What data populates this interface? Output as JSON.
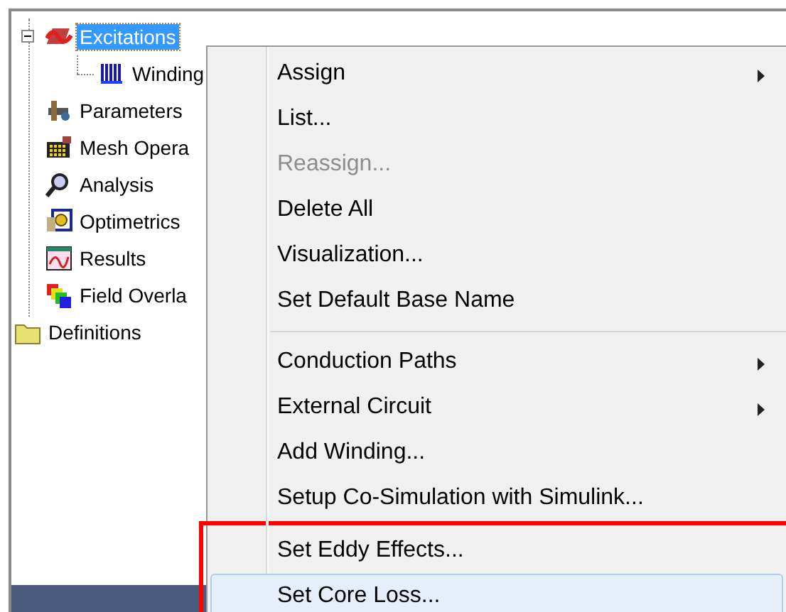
{
  "tree": {
    "items": [
      {
        "label": "Excitations",
        "kind": "excitations",
        "selected": true,
        "expanded": true,
        "children": [
          {
            "label": "Winding",
            "kind": "winding",
            "selected": false
          }
        ]
      },
      {
        "label": "Parameters",
        "kind": "parameters",
        "selected": false
      },
      {
        "label": "Mesh Opera",
        "kind": "mesh",
        "selected": false
      },
      {
        "label": "Analysis",
        "kind": "analysis",
        "selected": false
      },
      {
        "label": "Optimetrics",
        "kind": "optimetrics",
        "selected": false
      },
      {
        "label": "Results",
        "kind": "results",
        "selected": false
      },
      {
        "label": "Field Overla",
        "kind": "field",
        "selected": false
      }
    ],
    "root_items": [
      {
        "label": "Definitions",
        "kind": "folder",
        "selected": false
      }
    ]
  },
  "context_menu": {
    "items": [
      {
        "kind": "item",
        "label": "Assign",
        "submenu": true,
        "disabled": false,
        "selected": false,
        "highlighted": false
      },
      {
        "kind": "item",
        "label": "List...",
        "submenu": false,
        "disabled": false,
        "selected": false,
        "highlighted": false
      },
      {
        "kind": "item",
        "label": "Reassign...",
        "submenu": false,
        "disabled": true,
        "selected": false,
        "highlighted": false
      },
      {
        "kind": "item",
        "label": "Delete All",
        "submenu": false,
        "disabled": false,
        "selected": false,
        "highlighted": false
      },
      {
        "kind": "item",
        "label": "Visualization...",
        "submenu": false,
        "disabled": false,
        "selected": false,
        "highlighted": false
      },
      {
        "kind": "item",
        "label": "Set Default Base Name",
        "submenu": false,
        "disabled": false,
        "selected": false,
        "highlighted": false
      },
      {
        "kind": "separator"
      },
      {
        "kind": "item",
        "label": "Conduction Paths",
        "submenu": true,
        "disabled": false,
        "selected": false,
        "highlighted": false
      },
      {
        "kind": "item",
        "label": "External Circuit",
        "submenu": true,
        "disabled": false,
        "selected": false,
        "highlighted": false
      },
      {
        "kind": "item",
        "label": "Add Winding...",
        "submenu": false,
        "disabled": false,
        "selected": false,
        "highlighted": false
      },
      {
        "kind": "item",
        "label": "Setup Co-Simulation with Simulink...",
        "submenu": false,
        "disabled": false,
        "selected": false,
        "highlighted": false
      },
      {
        "kind": "item",
        "label": "Set Eddy Effects...",
        "submenu": false,
        "disabled": false,
        "selected": false,
        "highlighted": true
      },
      {
        "kind": "item",
        "label": "Set Core Loss...",
        "submenu": false,
        "disabled": false,
        "selected": true,
        "highlighted": true
      }
    ]
  }
}
